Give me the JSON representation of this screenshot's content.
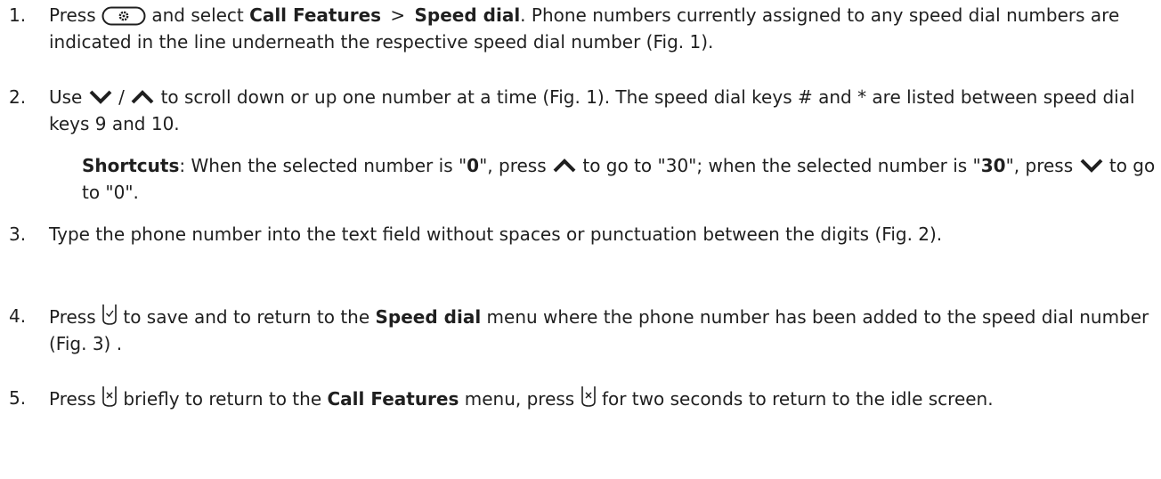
{
  "steps": [
    {
      "number": "1.",
      "p1": "Press",
      "p2": "and select",
      "b1": "Call Features",
      "sep": ">",
      "b2": "Speed dial",
      "p3": ".  Phone numbers currently assigned to any speed dial numbers are indicated in the line underneath the respective speed dial number (Fig. 1)."
    },
    {
      "number": "2.",
      "p1": "Use",
      "slash": "/",
      "p2": "to scroll down or up one number at a time (Fig. 1).  The speed dial keys # and * are listed between speed dial keys 9 and 10."
    },
    {
      "number": "3.",
      "p1": "Type the phone number into the text field without spaces or punctuation between the digits (Fig. 2)."
    },
    {
      "number": "4.",
      "p1": "Press",
      "p2": "to save and to return to the",
      "b1": "Speed dial",
      "p3": "menu where the phone number has been added to the speed dial number (Fig. 3) ."
    },
    {
      "number": "5.",
      "p1": "Press",
      "p2": "briefly to return to the",
      "b1": "Call Features",
      "p3": "menu, press",
      "p4": "for two seconds to return to the idle screen."
    }
  ],
  "shortcuts": {
    "label": "Shortcuts",
    "t1": ":  When the selected number is \"",
    "v1": "0",
    "t2": "\", press",
    "t3": "to go to \"30\"; when the selected number is \"",
    "v2": "30",
    "t4": "\", press",
    "t5": "to go to \"0\"."
  },
  "icons": {
    "menu_key": "menu-key-icon",
    "down": "chevron-down-icon",
    "up": "chevron-up-icon",
    "ok_key": "ok-softkey-icon",
    "cancel_key": "cancel-softkey-icon"
  }
}
